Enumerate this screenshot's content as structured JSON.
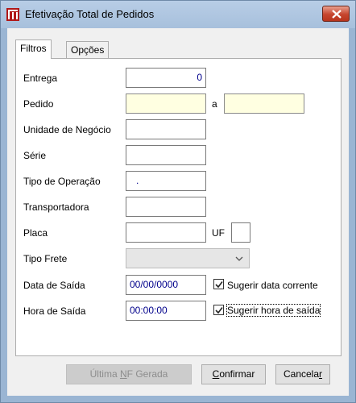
{
  "window": {
    "title": "Efetivação Total de Pedidos"
  },
  "tabs": [
    {
      "label": "Filtros",
      "active": true
    },
    {
      "label": "Opções",
      "active": false
    }
  ],
  "form": {
    "entrega": {
      "label": "Entrega",
      "value": "0"
    },
    "pedido": {
      "label": "Pedido",
      "from": "",
      "to": "",
      "separator": "a"
    },
    "unidade": {
      "label": "Unidade de Negócio",
      "value": ""
    },
    "serie": {
      "label": "Série",
      "value": ""
    },
    "tipo_operacao": {
      "label": "Tipo de Operação",
      "value": "."
    },
    "transportadora": {
      "label": "Transportadora",
      "value": ""
    },
    "placa": {
      "label": "Placa",
      "value": "",
      "uf_label": "UF",
      "uf_value": ""
    },
    "tipo_frete": {
      "label": "Tipo Frete",
      "value": ""
    },
    "data_saida": {
      "label": "Data de Saída",
      "value": "00/00/0000",
      "checkbox_label": "Sugerir data corrente",
      "checked": true
    },
    "hora_saida": {
      "label": "Hora de Saída",
      "value": "00:00:00",
      "checkbox_label": "Sugerir hora de saída",
      "checked": true
    }
  },
  "buttons": {
    "ultima_pre": "Última ",
    "ultima_u": "N",
    "ultima_post": "F Gerada",
    "confirmar_u": "C",
    "confirmar_post": "onfirmar",
    "cancelar_pre": "Cancela",
    "cancelar_u": "r"
  },
  "colors": {
    "title_bar": "#a7c0dc",
    "close_button": "#c6452e",
    "highlight_field": "#ffffe1",
    "value_text": "#00008b"
  },
  "icons": {
    "app": "app-logo-icon",
    "close": "close-icon",
    "dropdown": "chevron-down-icon",
    "check": "checkmark-icon"
  }
}
